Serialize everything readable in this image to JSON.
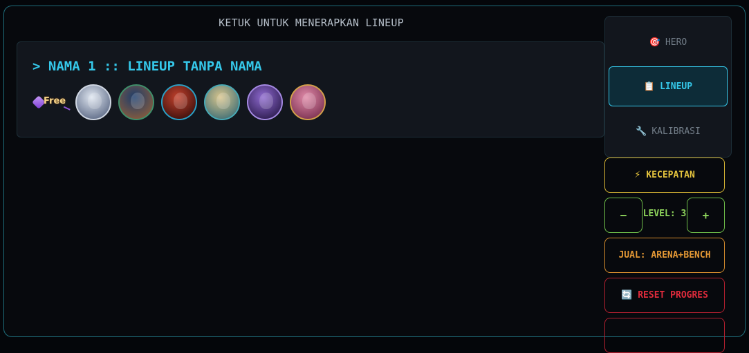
{
  "hint": "KETUK UNTUK MENERAPKAN LINEUP",
  "lineup": {
    "title": "> NAMA 1 :: LINEUP TANPA NAMA",
    "badge": "Free",
    "heroes": [
      {
        "name": "hero-portrait",
        "colors": [
          "#dfe6f0",
          "#5d6a86"
        ],
        "border": "#cfd6e2"
      },
      {
        "name": "hero-portrait",
        "colors": [
          "#1c3d6b",
          "#8a5c3c"
        ],
        "border": "#3f8f6a"
      },
      {
        "name": "hero-portrait",
        "colors": [
          "#c2412c",
          "#3b0f0c"
        ],
        "border": "#2aa0c6"
      },
      {
        "name": "hero-portrait",
        "colors": [
          "#d9c58c",
          "#3f6e76"
        ],
        "border": "#47a9b5"
      },
      {
        "name": "hero-portrait",
        "colors": [
          "#8f6ad0",
          "#2b1b4d"
        ],
        "border": "#a58ae3"
      },
      {
        "name": "hero-portrait",
        "colors": [
          "#e08aa8",
          "#7a3050"
        ],
        "border": "#d3a04a"
      }
    ]
  },
  "nav": {
    "hero": {
      "icon": "🎯",
      "label": "HERO"
    },
    "lineup": {
      "icon": "📋",
      "label": "LINEUP"
    },
    "kalibrasi": {
      "icon": "🔧",
      "label": "KALIBRASI"
    }
  },
  "controls": {
    "speed": {
      "icon": "⚡",
      "label": "KECEPATAN"
    },
    "level_minus": "−",
    "level_label": "LEVEL: 3",
    "level_plus": "+",
    "sell": "JUAL: ARENA+BENCH",
    "reset": {
      "icon": "🔄",
      "label": "RESET PROGRES"
    }
  }
}
